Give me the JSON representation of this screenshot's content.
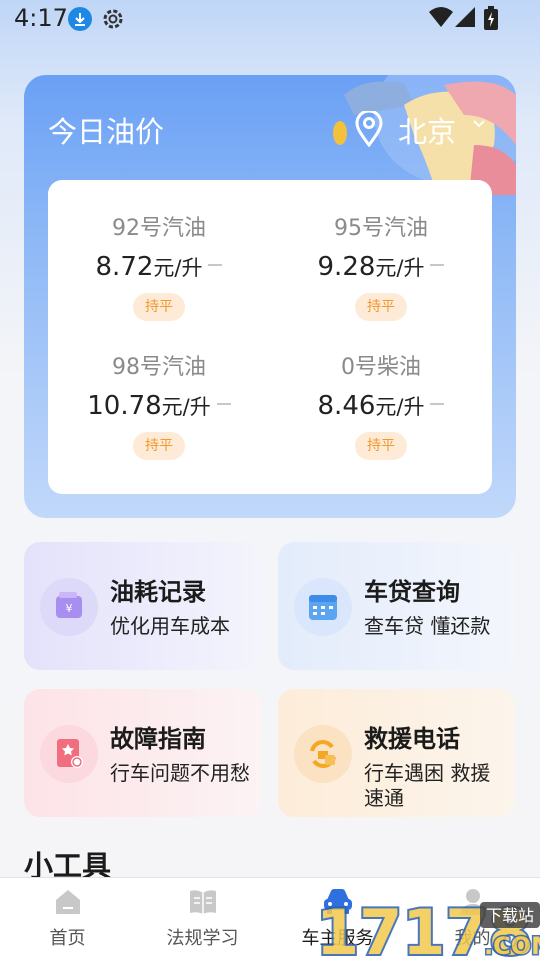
{
  "status_bar": {
    "time": "4:17"
  },
  "oil_card": {
    "title": "今日油价",
    "city": "北京",
    "prices": [
      {
        "name": "92号汽油",
        "value": "8.72",
        "unit": "元/升",
        "trend": "持平"
      },
      {
        "name": "95号汽油",
        "value": "9.28",
        "unit": "元/升",
        "trend": "持平"
      },
      {
        "name": "98号汽油",
        "value": "10.78",
        "unit": "元/升",
        "trend": "持平"
      },
      {
        "name": "0号柴油",
        "value": "8.46",
        "unit": "元/升",
        "trend": "持平"
      }
    ]
  },
  "features": [
    {
      "title": "油耗记录",
      "subtitle": "优化用车成本",
      "icon": "wallet-icon"
    },
    {
      "title": "车贷查询",
      "subtitle": "查车贷 懂还款",
      "icon": "calendar-icon"
    },
    {
      "title": "故障指南",
      "subtitle": "行车问题不用愁",
      "icon": "guide-book-icon"
    },
    {
      "title": "救援电话",
      "subtitle": "行车遇困 救援速通",
      "icon": "rescue-icon"
    }
  ],
  "tools": {
    "title": "小工具"
  },
  "bottom_nav": {
    "items": [
      {
        "label": "首页",
        "icon": "home-icon",
        "active": false
      },
      {
        "label": "法规学习",
        "icon": "book-icon",
        "active": false
      },
      {
        "label": "车主服务",
        "icon": "car-icon",
        "active": true
      },
      {
        "label": "我的",
        "icon": "profile-icon",
        "active": false
      }
    ]
  },
  "watermark": {
    "text": "17178",
    "suffix": ".COM",
    "tag": "下载站"
  },
  "colors": {
    "accent_blue": "#6aa0f5",
    "badge_bg": "#fdebd7",
    "badge_text": "#f29a2e",
    "active_nav": "#2f6fe0"
  }
}
